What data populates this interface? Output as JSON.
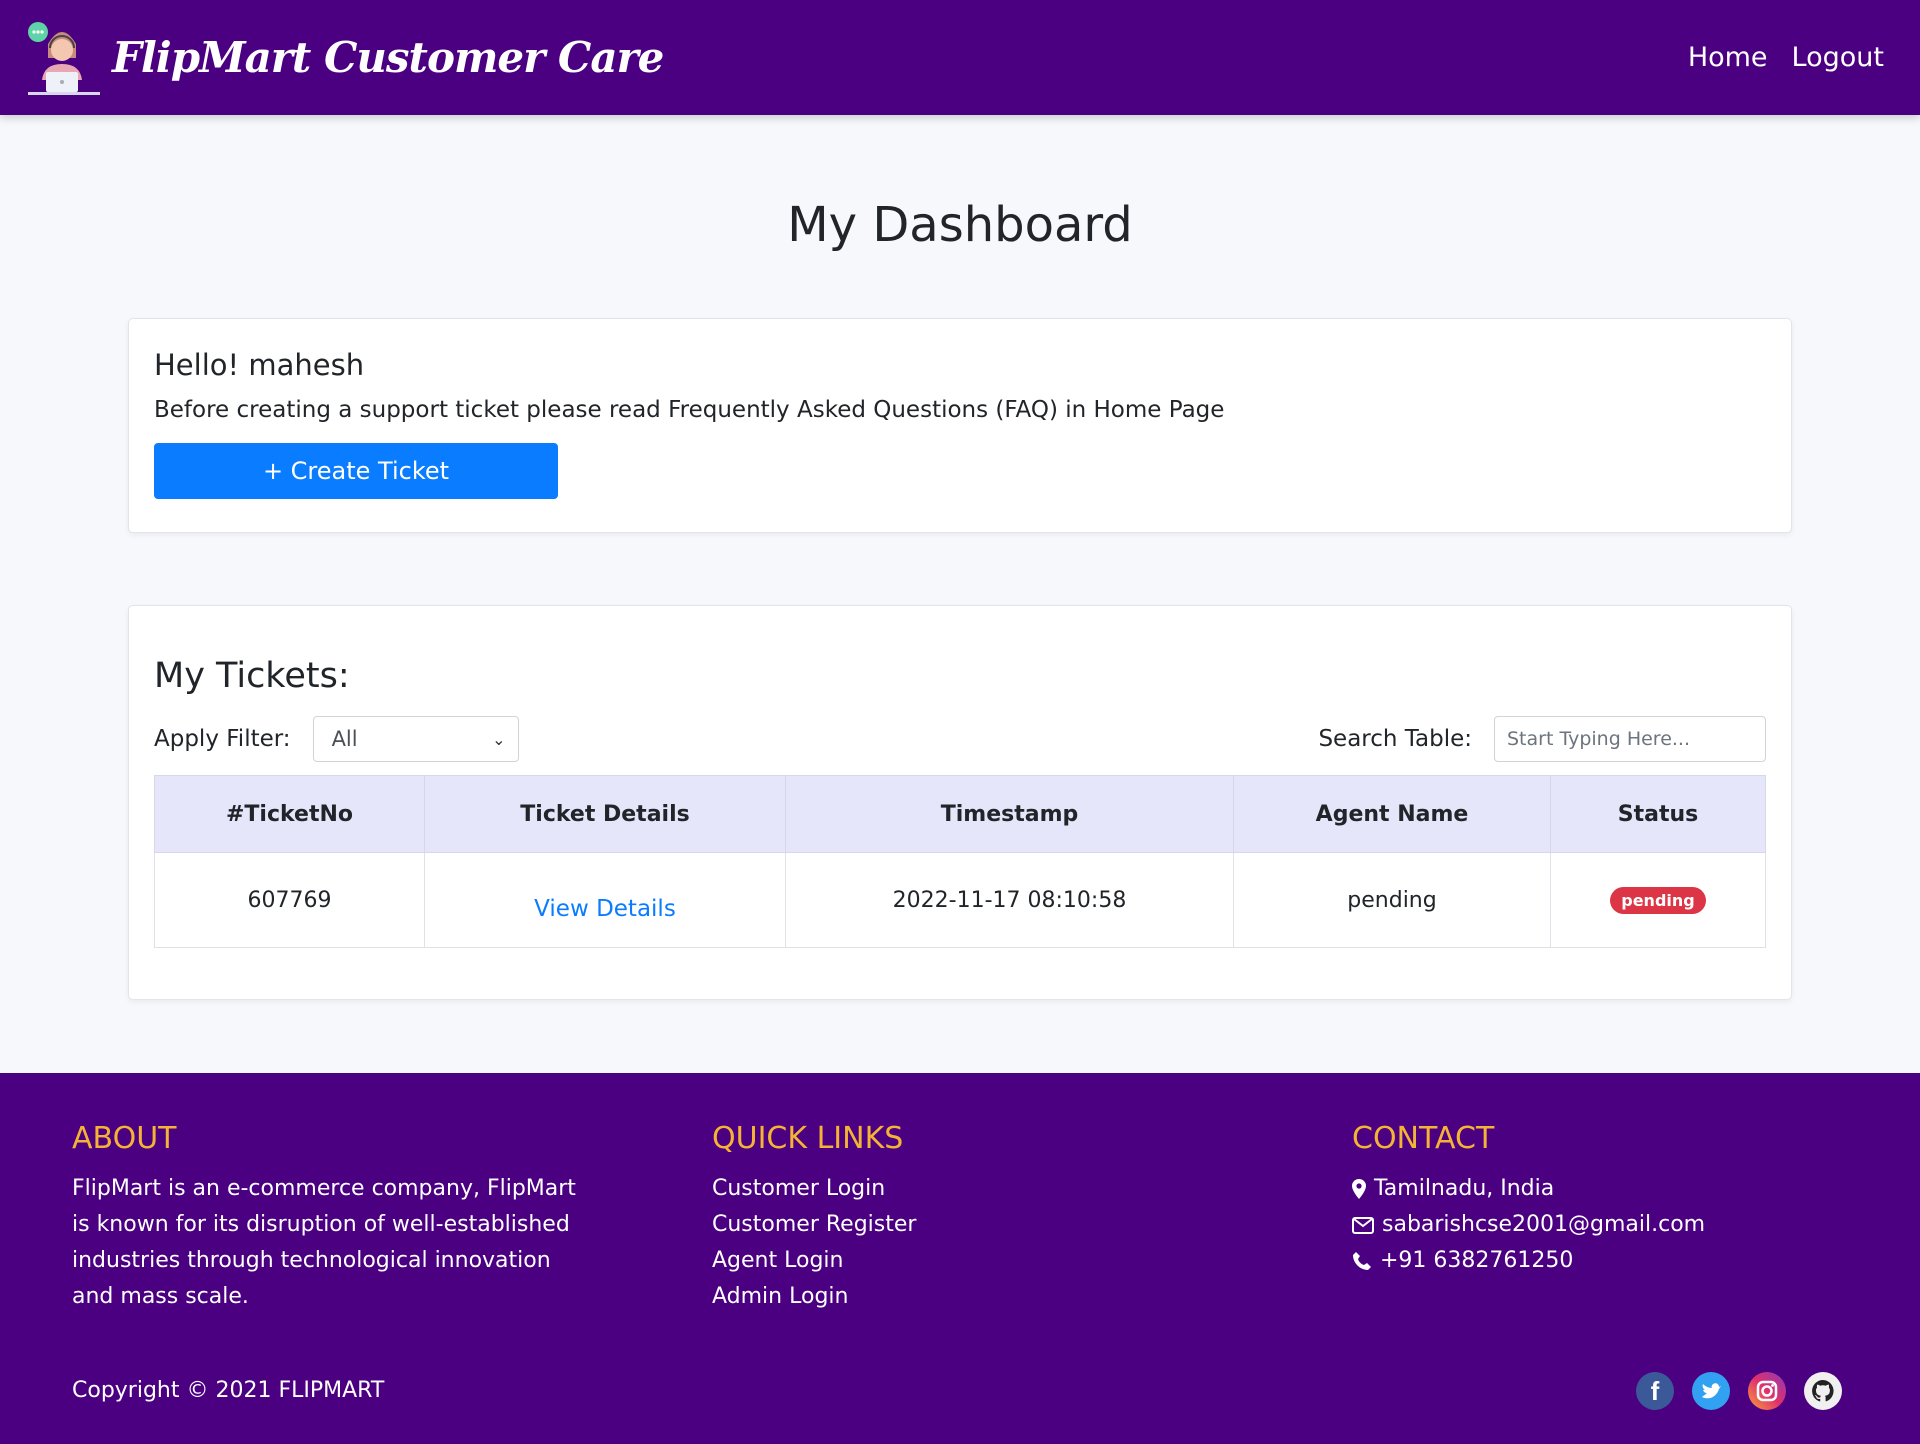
{
  "navbar": {
    "brand_title": "FlipMart Customer Care",
    "links": [
      {
        "label": "Home"
      },
      {
        "label": "Logout"
      }
    ]
  },
  "page": {
    "title": "My Dashboard"
  },
  "welcome": {
    "heading": "Hello! mahesh",
    "text": "Before creating a support ticket please read Frequently Asked Questions (FAQ) in Home Page",
    "create_button": "+ Create Ticket"
  },
  "tickets": {
    "heading": "My Tickets:",
    "filter_label": "Apply Filter:",
    "filter_value": "All",
    "search_label": "Search Table:",
    "search_placeholder": "Start Typing Here...",
    "columns": [
      "#TicketNo",
      "Ticket Details",
      "Timestamp",
      "Agent Name",
      "Status"
    ],
    "rows": [
      {
        "ticket_no": "607769",
        "details": "View Details",
        "timestamp": "2022-11-17 08:10:58",
        "agent": "pending",
        "status": "pending"
      }
    ]
  },
  "footer": {
    "about": {
      "heading": "ABOUT",
      "text": "FlipMart is an e-commerce company, FlipMart is known for its disruption of well-established industries through technological innovation and mass scale."
    },
    "quick_links": {
      "heading": "QUICK LINKS",
      "items": [
        "Customer Login",
        "Customer Register",
        "Agent Login",
        "Admin Login"
      ]
    },
    "contact": {
      "heading": "CONTACT",
      "location": "Tamilnadu, India",
      "email": "sabarishcse2001@gmail.com",
      "phone": "+91 6382761250"
    },
    "copyright": "Copyright © 2021 FLIPMART",
    "socials": [
      "facebook-icon",
      "twitter-icon",
      "instagram-icon",
      "github-icon"
    ]
  },
  "colors": {
    "brand": "#4b0082",
    "accent": "#0a7cff",
    "footer_heading": "#f5b335",
    "badge_danger": "#dc3545",
    "table_header": "#e6e6fa"
  }
}
